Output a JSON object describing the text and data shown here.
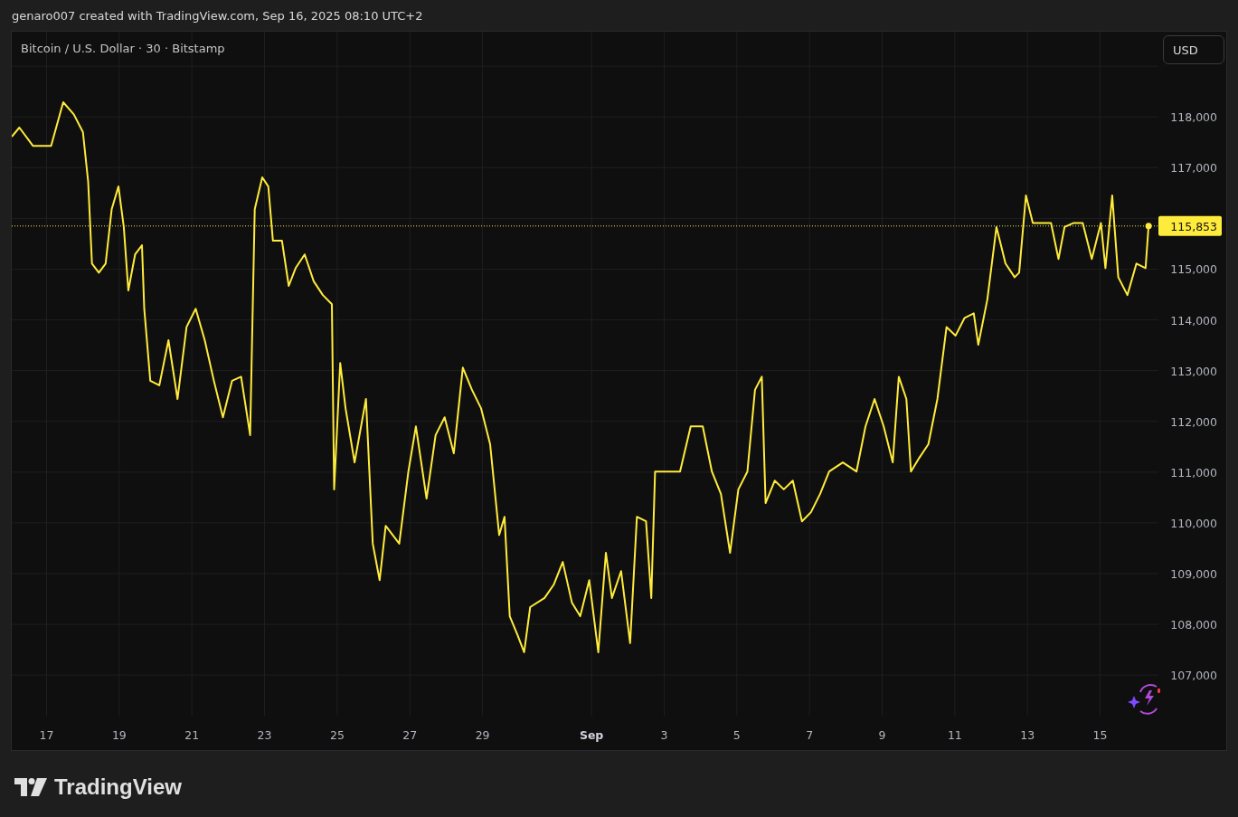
{
  "header": {
    "text": "genaro007 created with TradingView.com, Sep 16, 2025 08:10 UTC+2"
  },
  "chart": {
    "symbol": "Bitcoin / U.S. Dollar · 30 · Bitstamp",
    "currency_button": "USD",
    "price_tag": "115,853",
    "chart_data": {
      "type": "line",
      "x": [
        "2025-08-16T01:00",
        "2025-08-16T06:00",
        "2025-08-16T15:00",
        "2025-08-17T03:00",
        "2025-08-17T11:00",
        "2025-08-17T18:00",
        "2025-08-18T00:00",
        "2025-08-18T03:30",
        "2025-08-18T06:00",
        "2025-08-18T10:30",
        "2025-08-18T15:00",
        "2025-08-18T19:00",
        "2025-08-18T23:30",
        "2025-08-19T03:00",
        "2025-08-19T06:00",
        "2025-08-19T10:30",
        "2025-08-19T15:00",
        "2025-08-19T16:30",
        "2025-08-19T20:30",
        "2025-08-20T02:30",
        "2025-08-20T08:30",
        "2025-08-20T14:30",
        "2025-08-20T20:30",
        "2025-08-21T02:30",
        "2025-08-21T08:30",
        "2025-08-21T14:30",
        "2025-08-21T20:30",
        "2025-08-22T02:30",
        "2025-08-22T08:30",
        "2025-08-22T14:30",
        "2025-08-22T17:30",
        "2025-08-22T22:30",
        "2025-08-23T02:30",
        "2025-08-23T05:30",
        "2025-08-23T11:30",
        "2025-08-23T16:00",
        "2025-08-23T20:30",
        "2025-08-24T02:30",
        "2025-08-24T08:30",
        "2025-08-24T14:30",
        "2025-08-24T20:30",
        "2025-08-24T22:00",
        "2025-08-25T02:00",
        "2025-08-25T05:30",
        "2025-08-25T11:30",
        "2025-08-25T19:00",
        "2025-08-25T23:30",
        "2025-08-26T04:00",
        "2025-08-26T08:00",
        "2025-08-26T17:00",
        "2025-08-26T23:00",
        "2025-08-27T04:00",
        "2025-08-27T11:00",
        "2025-08-27T17:00",
        "2025-08-27T23:00",
        "2025-08-28T05:00",
        "2025-08-28T11:00",
        "2025-08-28T17:00",
        "2025-08-28T23:00",
        "2025-08-29T05:00",
        "2025-08-29T11:00",
        "2025-08-29T14:30",
        "2025-08-29T18:00",
        "2025-08-29T23:00",
        "2025-08-30T03:30",
        "2025-08-30T07:30",
        "2025-08-30T17:00",
        "2025-08-30T23:00",
        "2025-08-31T05:00",
        "2025-08-31T11:00",
        "2025-08-31T16:30",
        "2025-08-31T22:30",
        "2025-09-01T04:30",
        "2025-09-01T09:30",
        "2025-09-01T13:30",
        "2025-09-01T19:30",
        "2025-09-02T01:30",
        "2025-09-02T06:00",
        "2025-09-02T12:00",
        "2025-09-02T15:30",
        "2025-09-02T18:00",
        "2025-09-03T01:30",
        "2025-09-03T10:30",
        "2025-09-03T17:30",
        "2025-09-04T01:30",
        "2025-09-04T07:30",
        "2025-09-04T13:30",
        "2025-09-04T19:30",
        "2025-09-05T01:00",
        "2025-09-05T07:00",
        "2025-09-05T12:00",
        "2025-09-05T16:30",
        "2025-09-05T19:00",
        "2025-09-06T01:00",
        "2025-09-06T07:00",
        "2025-09-06T13:00",
        "2025-09-06T19:00",
        "2025-09-07T01:00",
        "2025-09-07T07:00",
        "2025-09-07T13:00",
        "2025-09-07T22:00",
        "2025-09-08T07:00",
        "2025-09-08T13:00",
        "2025-09-08T19:00",
        "2025-09-09T01:00",
        "2025-09-09T07:00",
        "2025-09-09T11:00",
        "2025-09-09T16:00",
        "2025-09-09T19:00",
        "2025-09-10T00:30",
        "2025-09-10T06:30",
        "2025-09-10T12:30",
        "2025-09-10T18:30",
        "2025-09-11T00:30",
        "2025-09-11T06:30",
        "2025-09-11T12:30",
        "2025-09-11T15:30",
        "2025-09-11T21:30",
        "2025-09-12T03:30",
        "2025-09-12T09:30",
        "2025-09-12T15:30",
        "2025-09-12T18:30",
        "2025-09-12T23:00",
        "2025-09-13T03:30",
        "2025-09-13T09:30",
        "2025-09-13T15:30",
        "2025-09-13T20:30",
        "2025-09-14T00:30",
        "2025-09-14T06:30",
        "2025-09-14T12:30",
        "2025-09-14T18:30",
        "2025-09-15T00:30",
        "2025-09-15T03:30",
        "2025-09-15T08:00",
        "2025-09-15T12:00",
        "2025-09-15T18:00",
        "2025-09-16T00:00",
        "2025-09-16T06:00",
        "2025-09-16T08:00"
      ],
      "values": [
        117610,
        117790,
        117430,
        117430,
        118290,
        118050,
        117700,
        116720,
        115110,
        114930,
        115110,
        116180,
        116630,
        115830,
        114580,
        115290,
        115470,
        114220,
        112800,
        112710,
        113600,
        112440,
        113860,
        114220,
        113600,
        112800,
        112080,
        112800,
        112880,
        111730,
        116180,
        116810,
        116630,
        115560,
        115560,
        114670,
        115020,
        115290,
        114760,
        114490,
        114310,
        110660,
        113150,
        112260,
        111190,
        112440,
        109590,
        108870,
        109940,
        109590,
        111010,
        111900,
        110480,
        111730,
        112080,
        111370,
        113060,
        112620,
        112260,
        111550,
        109760,
        110120,
        108160,
        107800,
        107450,
        108340,
        108520,
        108780,
        109230,
        108430,
        108160,
        108870,
        107450,
        109410,
        108520,
        109050,
        107630,
        110120,
        110030,
        108520,
        111010,
        111010,
        111010,
        111900,
        111900,
        111010,
        110570,
        109410,
        110660,
        111010,
        112620,
        112880,
        110390,
        110830,
        110660,
        110830,
        110030,
        110210,
        110570,
        111010,
        111190,
        111010,
        111900,
        112440,
        111900,
        111190,
        112880,
        112440,
        111010,
        111280,
        111550,
        112440,
        113860,
        113690,
        114040,
        114130,
        113510,
        114400,
        115830,
        115110,
        114840,
        114930,
        116450,
        115910,
        115910,
        115910,
        115200,
        115830,
        115910,
        115910,
        115200,
        115910,
        115020,
        116450,
        114840,
        114490,
        115110,
        115020,
        115850
      ],
      "grid": true,
      "ref_lines": [
        {
          "axis": "y",
          "value": 115850
        }
      ],
      "xlim": [
        "2025-08-16T01:00",
        "2025-09-16T14:30"
      ],
      "ylim": [
        106200,
        119680
      ],
      "xticks": [
        {
          "value": "2025-08-17",
          "label": "17"
        },
        {
          "value": "2025-08-19",
          "label": "19"
        },
        {
          "value": "2025-08-21",
          "label": "21"
        },
        {
          "value": "2025-08-23",
          "label": "23"
        },
        {
          "value": "2025-08-25",
          "label": "25"
        },
        {
          "value": "2025-08-27",
          "label": "27"
        },
        {
          "value": "2025-08-29",
          "label": "29"
        },
        {
          "value": "2025-09-01",
          "label": "Sep"
        },
        {
          "value": "2025-09-03",
          "label": "3"
        },
        {
          "value": "2025-09-05",
          "label": "5"
        },
        {
          "value": "2025-09-07",
          "label": "7"
        },
        {
          "value": "2025-09-09",
          "label": "9"
        },
        {
          "value": "2025-09-11",
          "label": "11"
        },
        {
          "value": "2025-09-13",
          "label": "13"
        },
        {
          "value": "2025-09-15",
          "label": "15"
        }
      ],
      "yticks": [
        {
          "value": 107000,
          "label": "107,000"
        },
        {
          "value": 108000,
          "label": "108,000"
        },
        {
          "value": 109000,
          "label": "109,000"
        },
        {
          "value": 110000,
          "label": "110,000"
        },
        {
          "value": 111000,
          "label": "111,000"
        },
        {
          "value": 112000,
          "label": "112,000"
        },
        {
          "value": 113000,
          "label": "113,000"
        },
        {
          "value": 114000,
          "label": "114,000"
        },
        {
          "value": 115000,
          "label": "115,000"
        },
        {
          "value": 117000,
          "label": "117,000"
        },
        {
          "value": 118000,
          "label": "118,000"
        }
      ]
    }
  },
  "footer": {
    "logo_text": "TradingView"
  }
}
